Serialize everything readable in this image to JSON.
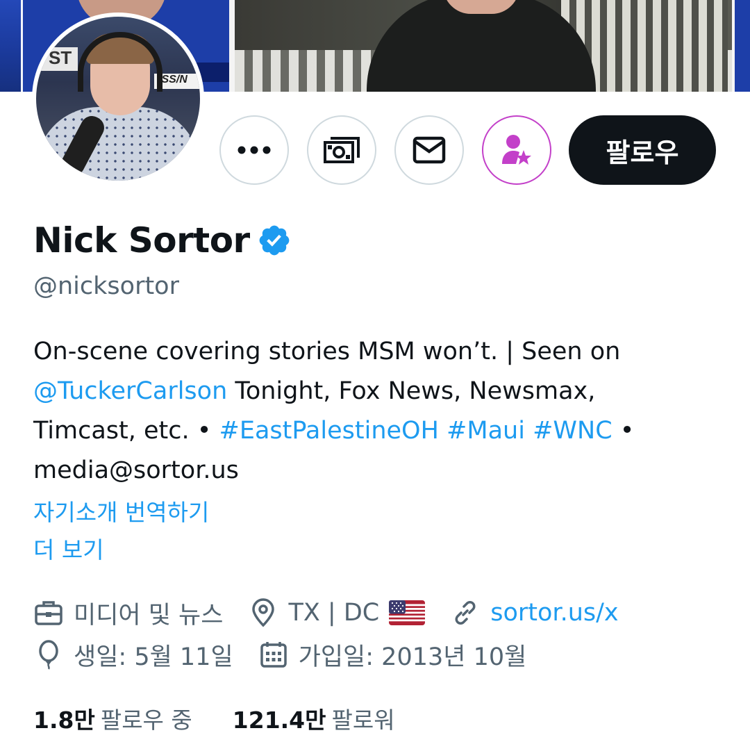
{
  "profile": {
    "name": "Nick Sortor",
    "handle": "@nicksortor",
    "bio": {
      "line1": "On-scene covering stories MSM won’t. | Seen on",
      "mention": "@TuckerCarlson",
      "line2_rest": " Tonight, Fox News, Newsmax,",
      "line3_start": "Timcast, etc. • ",
      "hashtag1": "#EastPalestineOH",
      "hashtag2": "#Maui",
      "hashtag3": "#WNC",
      "line3_end": " •",
      "line4": "media@sortor.us"
    },
    "translate_bio": "자기소개 번역하기",
    "show_more": "더 보기",
    "category": "미디어 및 뉴스",
    "location": "TX | DC",
    "website": "sortor.us/x",
    "birthday": "생일: 5월 11일",
    "joined": "가입일: 2013년 10월"
  },
  "actions": {
    "follow_label": "팔로우"
  },
  "stats": {
    "following_count": "1.8만",
    "following_label": "팔로우 중",
    "followers_count": "121.4만",
    "followers_label": "팔로워"
  },
  "icons": {
    "more": "more-icon",
    "tip": "money-icon",
    "message": "envelope-icon",
    "subscribe": "subscribe-star-icon",
    "verified": "verified-badge-icon",
    "category": "briefcase-icon",
    "location": "location-pin-icon",
    "website": "link-icon",
    "birthday": "balloon-icon",
    "joined": "calendar-icon",
    "flag": "us-flag-icon"
  },
  "colors": {
    "text_primary": "#0f1419",
    "text_secondary": "#536471",
    "link": "#1d9bf0",
    "subscribe_accent": "#c340c9",
    "verified": "#1d9bf0",
    "follow_bg": "#0f1419"
  }
}
